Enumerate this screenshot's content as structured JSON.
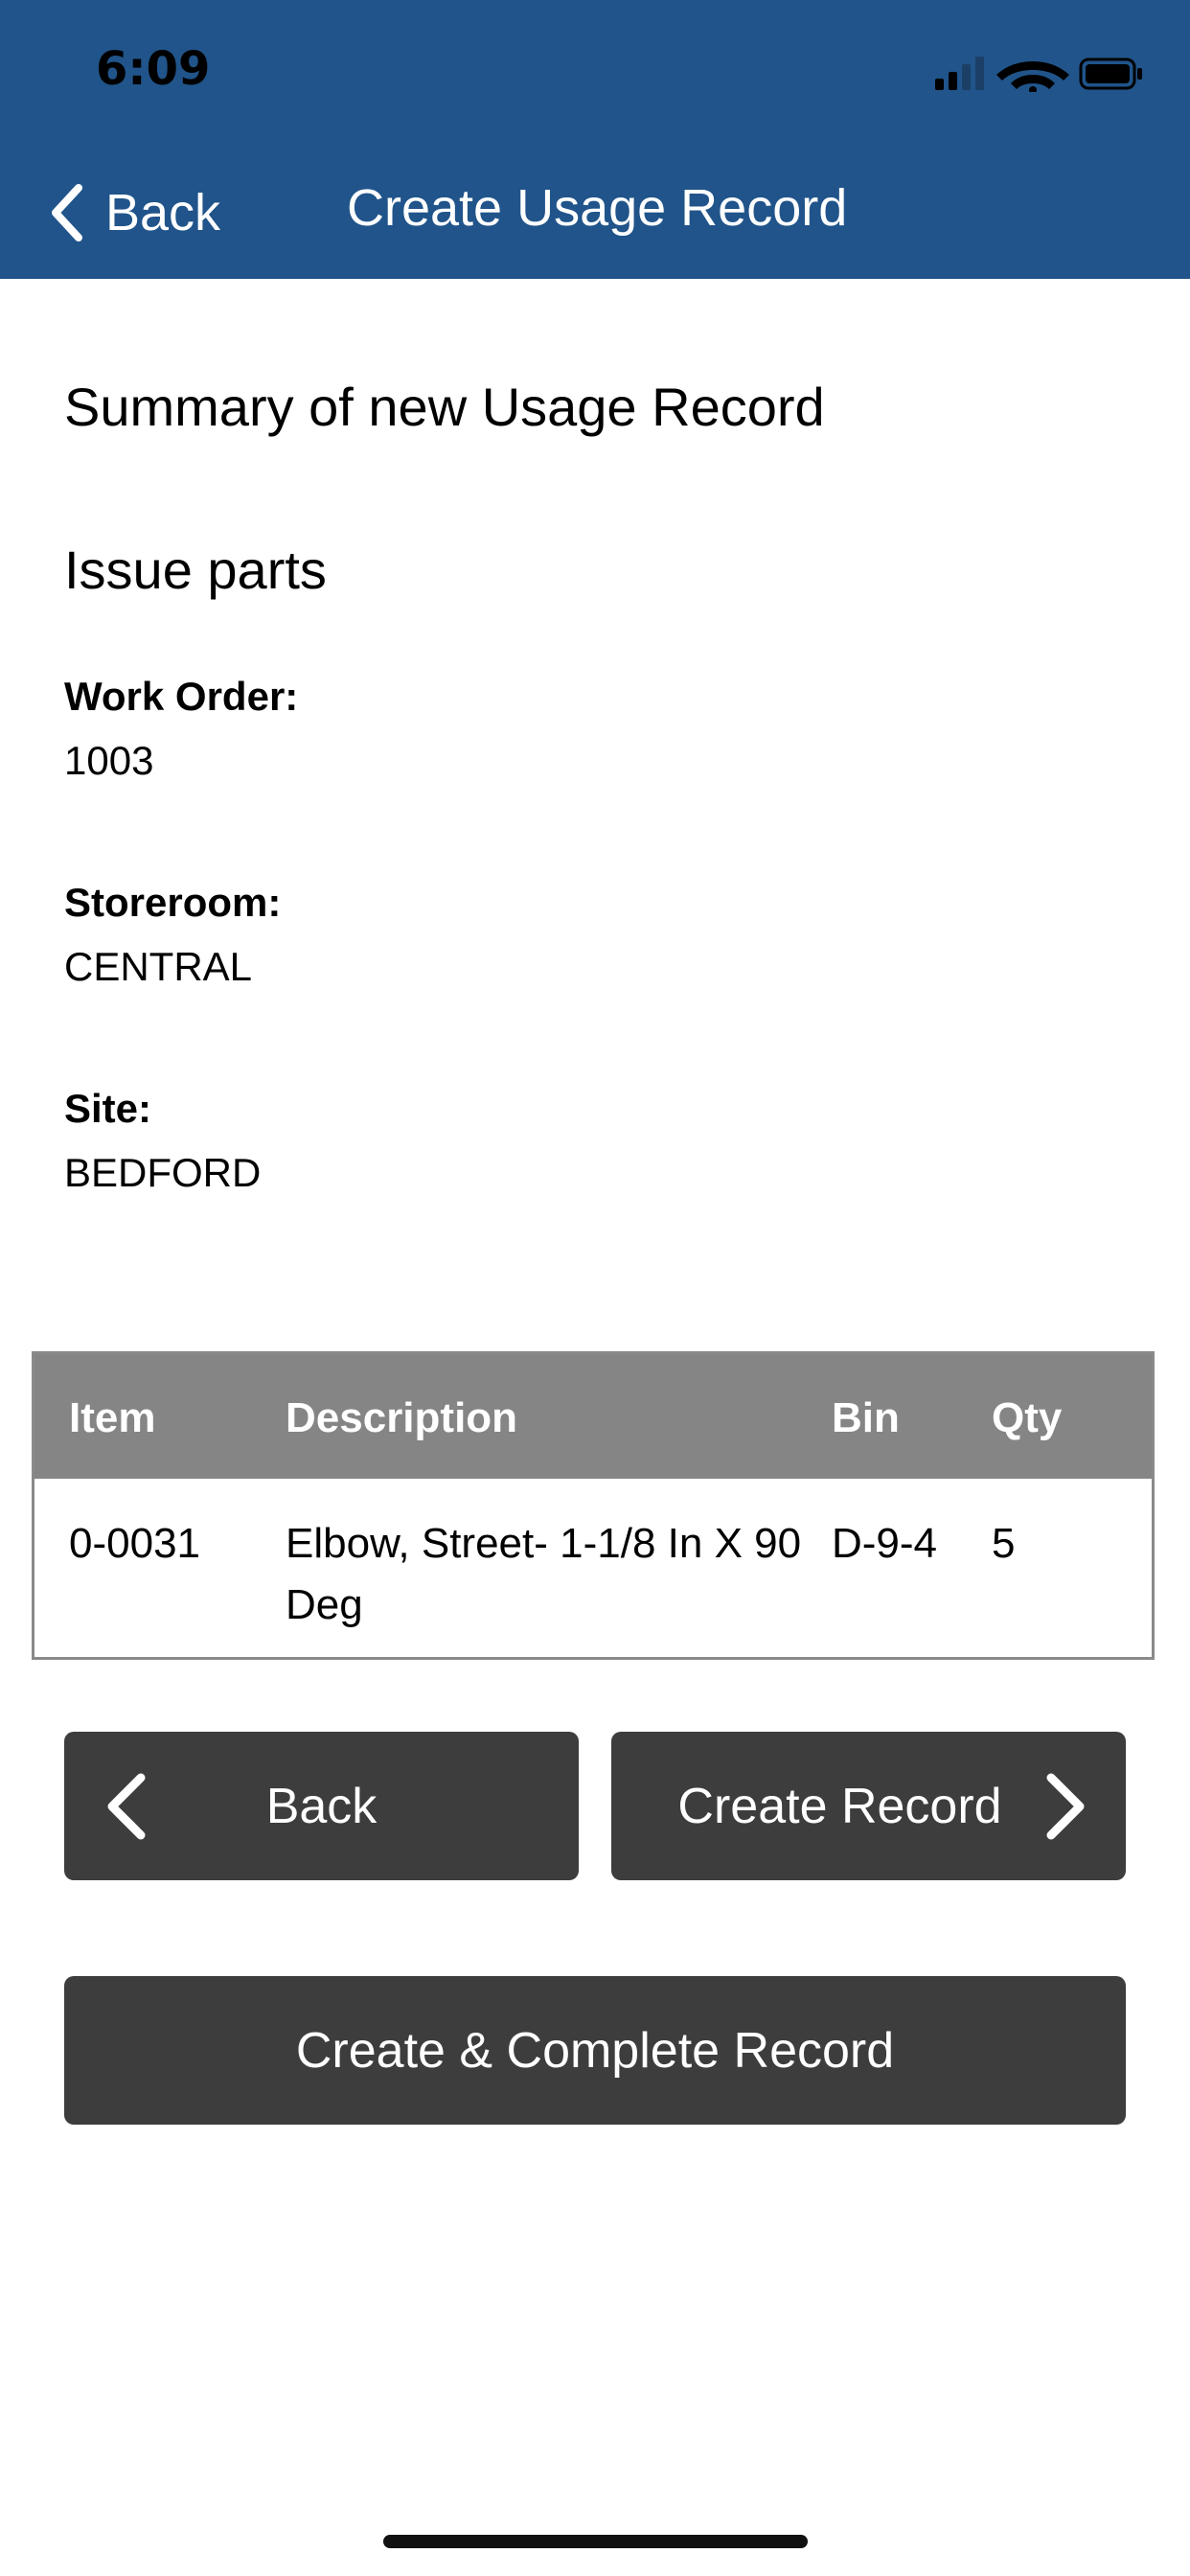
{
  "status_bar": {
    "time": "6:09"
  },
  "nav": {
    "back_label": "Back",
    "title": "Create Usage Record"
  },
  "summary": {
    "heading": "Summary of new Usage Record",
    "subheading": "Issue parts",
    "fields": [
      {
        "label": "Work Order:",
        "value": "1003"
      },
      {
        "label": "Storeroom:",
        "value": "CENTRAL"
      },
      {
        "label": "Site:",
        "value": "BEDFORD"
      }
    ]
  },
  "table": {
    "headers": [
      "Item",
      "Description",
      "Bin",
      "Qty"
    ],
    "rows": [
      [
        "0-0031",
        "Elbow, Street- 1-1/8 In X 90 Deg",
        "D-9-4",
        "5"
      ]
    ]
  },
  "actions": {
    "back_label": "Back",
    "create_label": "Create Record",
    "create_complete_label": "Create & Complete Record"
  },
  "colors": {
    "header_bg": "#20548a",
    "button_bg": "#3d3d3d",
    "table_header_bg": "#858585"
  },
  "icons": {
    "nav_back": "chevron-left-icon",
    "btn_back": "chevron-left-icon",
    "btn_next": "chevron-right-icon"
  }
}
